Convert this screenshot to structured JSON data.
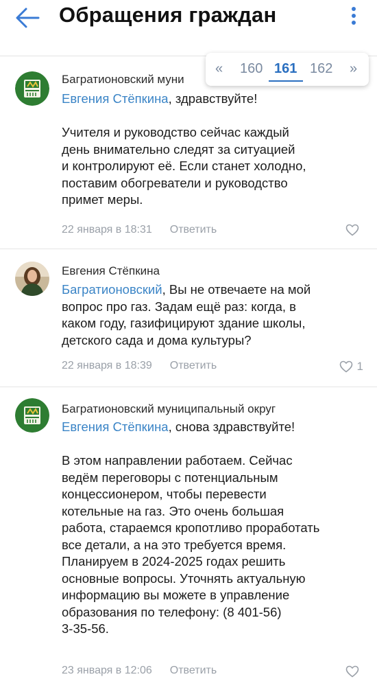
{
  "header": {
    "title": "Обращения граждан"
  },
  "pagination": {
    "prev": "«",
    "pages": [
      "160",
      "161",
      "162"
    ],
    "next": "»",
    "current": "161"
  },
  "comments": [
    {
      "author": "Багратионовский муни",
      "mention": "Евгения Стёпкина",
      "greeting": ", здравствуйте!",
      "text_lines": [
        "Учителя и руководство сейчас каждый",
        "день внимательно следят за ситуацией",
        "и контролируют её. Если станет холодно,",
        "поставим обогреватели и руководство",
        "примет меры."
      ],
      "date": "22 января в 18:31",
      "reply": "Ответить",
      "likes": ""
    },
    {
      "author": "Евгения Стёпкина",
      "mention": "Багратионовский",
      "greeting": ", Вы не отвечаете на мой",
      "text_lines": [
        "вопрос про газ. Задам ещё раз: когда, в",
        "каком году, газифицируют здание школы,",
        "детского сада и дома культуры?"
      ],
      "date": "22 января в 18:39",
      "reply": "Ответить",
      "likes": "1"
    },
    {
      "author": "Багратионовский муниципальный округ",
      "mention": "Евгения Стёпкина",
      "greeting": ", снова здравствуйте!",
      "text_lines": [
        "В этом направлении работаем. Сейчас",
        "ведём переговоры с потенциальным",
        "концессионером, чтобы перевести",
        "котельные на газ. Это очень большая",
        "работа, стараемся кропотливо проработать",
        "все детали, а на это требуется время.",
        "Планируем в 2024-2025 годах решить",
        "основные вопросы. Уточнять актуальную",
        "информацию вы можете в управление",
        "образования по телефону: (8 401-56)",
        "3-35-56."
      ],
      "date": "23 января в 12:06",
      "reply": "Ответить",
      "likes": ""
    }
  ],
  "icons": {
    "back": "arrow-left-icon",
    "menu": "more-vertical-icon",
    "like": "heart-outline-icon",
    "accent_color": "#3a84c6"
  }
}
